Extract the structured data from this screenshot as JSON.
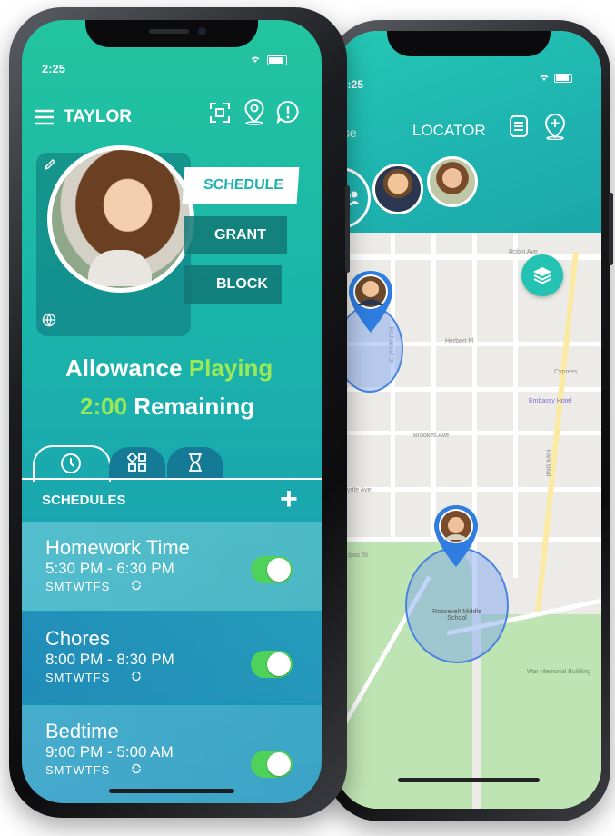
{
  "front": {
    "status_time": "2:25",
    "header": {
      "child_name": "TAYLOR"
    },
    "actions": [
      "SCHEDULE",
      "GRANT",
      "BLOCK"
    ],
    "allowance": {
      "word1": "Allowance",
      "word2": "Playing",
      "time": "2:00",
      "remaining": "Remaining"
    },
    "tabs": [
      "clock-icon",
      "apps-icon",
      "hourglass-icon"
    ],
    "section_title": "SCHEDULES",
    "add_label": "+",
    "schedules": [
      {
        "title": "Homework Time",
        "time": "5:30 PM - 6:30 PM",
        "days": "SMTWTFS",
        "enabled": true
      },
      {
        "title": "Chores",
        "time": "8:00 PM - 8:30 PM",
        "days": "SMTWTFS",
        "enabled": true
      },
      {
        "title": "Bedtime",
        "time": "9:00 PM - 5:00 AM",
        "days": "SMTWTFS",
        "enabled": true
      }
    ],
    "colors": {
      "accent_green": "#9bea55",
      "toggle_on": "#4fd25a",
      "teal": "#1ab6a9"
    }
  },
  "back": {
    "status_time": "2:25",
    "header": {
      "left_partial": "ose",
      "title": "LOCATOR"
    },
    "map": {
      "streets": [
        "Robin Ave",
        "Herbert Pl",
        "Cypress",
        "Embassy Hotel",
        "Brookes Ave",
        "Myrtle Ave",
        "Park Blvd",
        "Richmond St",
        "Upas St",
        "Roosevelt Middle School",
        "War Memorial Building"
      ]
    }
  }
}
